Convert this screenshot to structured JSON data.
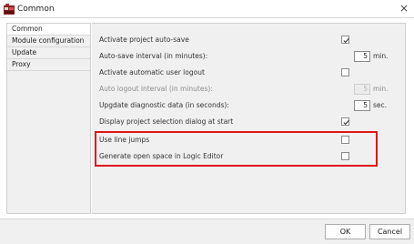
{
  "window": {
    "title": "Common",
    "close_glyph": "×"
  },
  "nav": {
    "items": [
      {
        "label": "Common"
      },
      {
        "label": "Module configuration"
      },
      {
        "label": "Update"
      },
      {
        "label": "Proxy"
      }
    ]
  },
  "settings": {
    "autosave": {
      "label": "Activate project auto-save",
      "checked": true
    },
    "autosave_interval": {
      "label": "Auto-save interval (in minutes):",
      "value": "5",
      "unit": "min."
    },
    "auto_logout": {
      "label": "Activate automatic user logout",
      "checked": false
    },
    "logout_interval": {
      "label": "Auto logout interval (in minutes):",
      "value": "5",
      "unit": "min."
    },
    "diagnostic": {
      "label": "Upgdate diagnostic data (in seconds):",
      "value": "5",
      "unit": "sec."
    },
    "selection_dialog": {
      "label": "Display project selection dialog at start",
      "checked": true
    },
    "line_jumps": {
      "label": "Use line jumps",
      "checked": false
    },
    "open_space": {
      "label": "Generate open space in Logic Editor",
      "checked": false
    }
  },
  "footer": {
    "ok_label": "OK",
    "cancel_label": "Cancel"
  },
  "colors": {
    "highlight": "#e0141e",
    "panel": "#f0f0f0"
  },
  "icons": {
    "app": "app-icon",
    "close": "close-icon",
    "check": "checkmark-icon"
  }
}
